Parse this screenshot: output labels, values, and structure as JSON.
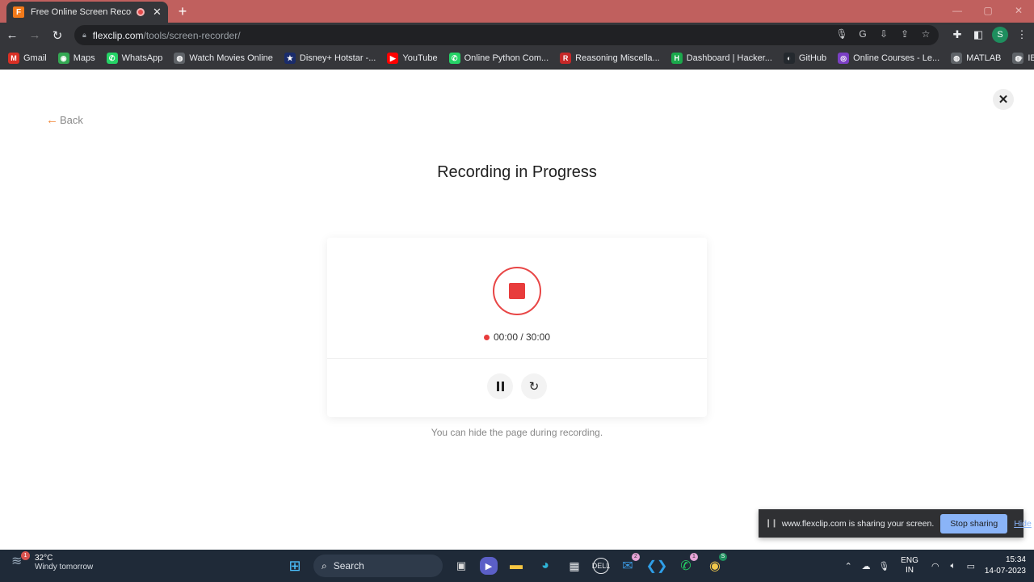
{
  "browser": {
    "tab": {
      "title": "Free Online Screen Recorder",
      "favicon": "F"
    },
    "url": {
      "host": "flexclip.com",
      "path": "/tools/screen-recorder/"
    },
    "profile_initial": "S",
    "bookmarks": [
      {
        "label": "Gmail",
        "icon": "gmail-icon",
        "color": "#d93025",
        "glyph": "M"
      },
      {
        "label": "Maps",
        "icon": "maps-icon",
        "color": "#34a853",
        "glyph": "◉"
      },
      {
        "label": "WhatsApp",
        "icon": "whatsapp-icon",
        "color": "#25d366",
        "glyph": "✆"
      },
      {
        "label": "Watch Movies Online",
        "icon": "globe-icon",
        "color": "#5f6368",
        "glyph": "◍"
      },
      {
        "label": "Disney+ Hotstar -...",
        "icon": "hotstar-icon",
        "color": "#1a2c6b",
        "glyph": "★"
      },
      {
        "label": "YouTube",
        "icon": "youtube-icon",
        "color": "#ff0000",
        "glyph": "▶"
      },
      {
        "label": "Online Python Com...",
        "icon": "whatsapp-icon",
        "color": "#25d366",
        "glyph": "✆"
      },
      {
        "label": "Reasoning Miscella...",
        "icon": "reasoning-icon",
        "color": "#c62828",
        "glyph": "R"
      },
      {
        "label": "Dashboard | Hacker...",
        "icon": "hackerrank-icon",
        "color": "#1ba94c",
        "glyph": "H"
      },
      {
        "label": "GitHub",
        "icon": "github-icon",
        "color": "#24292e",
        "glyph": "◐"
      },
      {
        "label": "Online Courses - Le...",
        "icon": "courses-icon",
        "color": "#7b3fc4",
        "glyph": "◎"
      },
      {
        "label": "MATLAB",
        "icon": "globe-icon",
        "color": "#5f6368",
        "glyph": "◍"
      },
      {
        "label": "IBM",
        "icon": "globe-icon",
        "color": "#5f6368",
        "glyph": "◍"
      }
    ],
    "more_glyph": "»"
  },
  "page": {
    "back_label": "Back",
    "title": "Recording in Progress",
    "timer": "00:00 / 30:00",
    "hint": "You can hide the page during recording."
  },
  "share_bar": {
    "text": "www.flexclip.com is sharing your screen.",
    "stop_label": "Stop sharing",
    "hide_label": "Hide"
  },
  "taskbar": {
    "weather_temp": "32°C",
    "weather_desc": "Windy tomorrow",
    "weather_badge": "1",
    "search_label": "Search",
    "teams_badge": "2",
    "whatsapp_badge": "1",
    "chrome_badge": "S",
    "lang_line1": "ENG",
    "lang_line2": "IN",
    "time": "15:34",
    "date": "14-07-2023"
  },
  "colors": {
    "accent_red": "#e83c3c",
    "back_arrow": "#f28a3c",
    "stop_sharing": "#8ab4f8"
  }
}
